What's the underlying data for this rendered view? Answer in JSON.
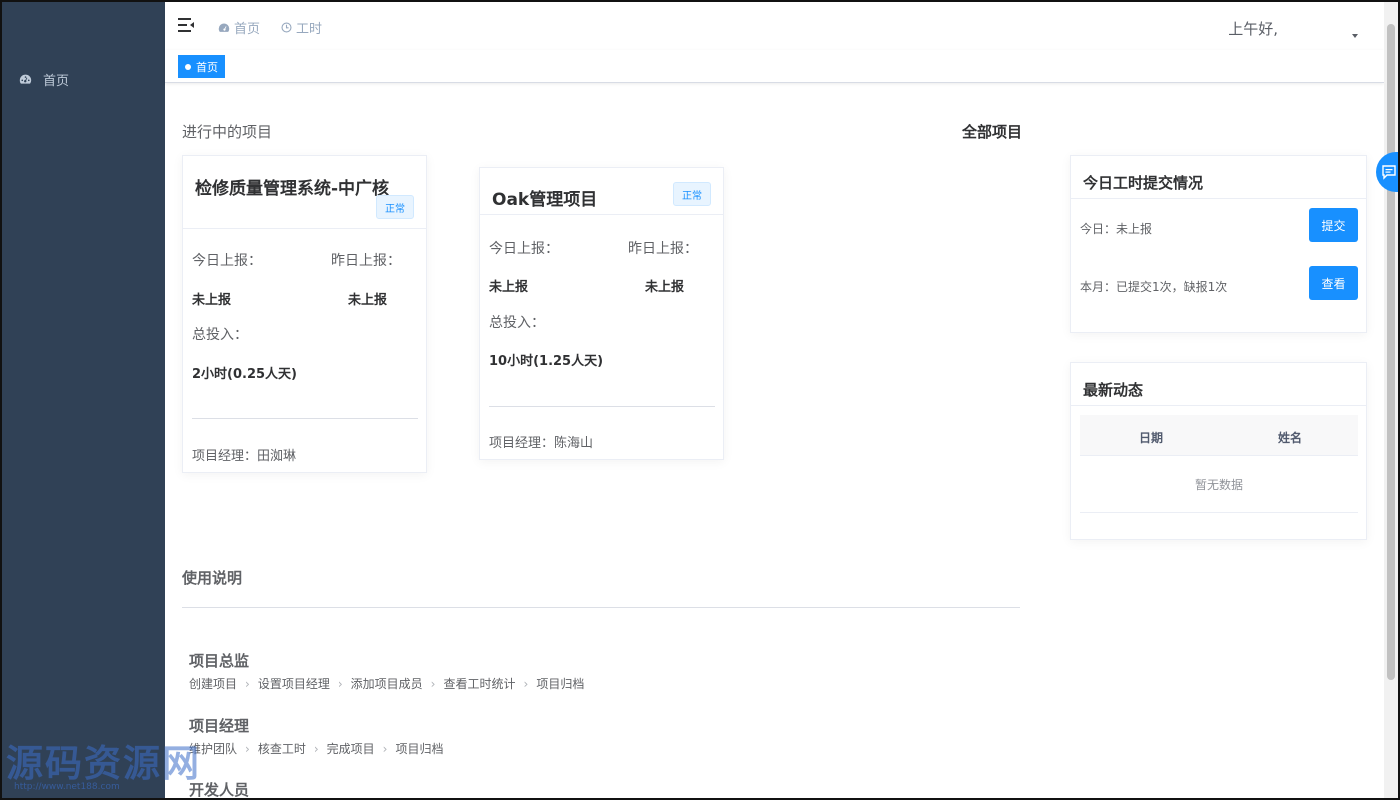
{
  "sidebar": {
    "items": [
      {
        "label": "首页",
        "icon": "dashboard-icon"
      }
    ]
  },
  "navbar": {
    "links": [
      {
        "label": "首页",
        "icon": "dashboard-icon"
      },
      {
        "label": "工时",
        "icon": "clock-icon"
      }
    ],
    "greeting": "上午好,"
  },
  "tags": {
    "active": "首页"
  },
  "main": {
    "in_progress_title": "进行中的项目",
    "all_projects_link": "全部项目",
    "projects": [
      {
        "name": "检修质量管理系统-中广核",
        "status": "正常",
        "today_label": "今日上报：",
        "today_value": "未上报",
        "yesterday_label": "昨日上报：",
        "yesterday_value": "未上报",
        "total_label": "总投入：",
        "total_value": "2小时(0.25人天)",
        "manager": "项目经理：田洳琳"
      },
      {
        "name": "Oak管理项目",
        "status": "正常",
        "today_label": "今日上报：",
        "today_value": "未上报",
        "yesterday_label": "昨日上报：",
        "yesterday_value": "未上报",
        "total_label": "总投入：",
        "total_value": "10小时(1.25人天)",
        "manager": "项目经理：陈海山"
      }
    ]
  },
  "worklog_card": {
    "title": "今日工时提交情况",
    "today_text": "今日：未上报",
    "submit_label": "提交",
    "month_text": "本月：已提交1次，缺报1次",
    "view_label": "查看"
  },
  "activity_card": {
    "title": "最新动态",
    "columns": [
      "日期",
      "姓名"
    ],
    "empty_text": "暂无数据"
  },
  "usage": {
    "title": "使用说明",
    "roles": [
      {
        "title": "项目总监",
        "steps": [
          "创建项目",
          "设置项目经理",
          "添加项目成员",
          "查看工时统计",
          "项目归档"
        ]
      },
      {
        "title": "项目经理",
        "steps": [
          "维护团队",
          "核查工时",
          "完成项目",
          "项目归档"
        ]
      },
      {
        "title": "开发人员",
        "steps": []
      }
    ]
  },
  "watermark": {
    "text": "源码资源网",
    "url": "http://www.net188.com"
  },
  "colors": {
    "sidebar": "#304156",
    "primary": "#1890ff",
    "sidebar_text": "#bfcbd9"
  }
}
